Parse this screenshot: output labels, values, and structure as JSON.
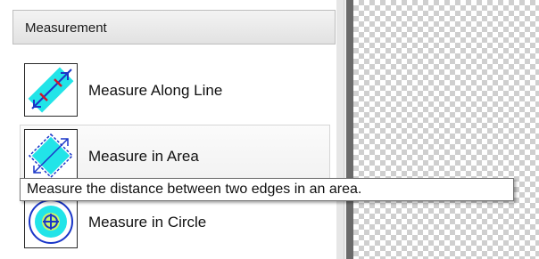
{
  "panel": {
    "title": "Measurement",
    "tools": [
      {
        "label": "Measure Along Line",
        "icon": "measure-along-line-icon"
      },
      {
        "label": "Measure in Area",
        "icon": "measure-in-area-icon"
      },
      {
        "label": "Measure in Circle",
        "icon": "measure-in-circle-icon"
      }
    ]
  },
  "tooltip": {
    "text": "Measure the distance between two edges in an area."
  },
  "colors": {
    "icon_fill": "#22e4e8",
    "icon_arrow_blue": "#1a36c8",
    "icon_marker_red": "#d2162a",
    "canvas_checker": "#cfcfcf"
  }
}
